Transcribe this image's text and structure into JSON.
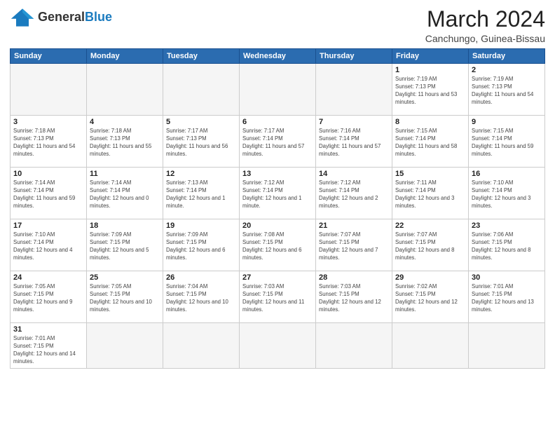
{
  "header": {
    "logo_text_regular": "General",
    "logo_text_bold": "Blue",
    "main_title": "March 2024",
    "subtitle": "Canchungo, Guinea-Bissau"
  },
  "weekdays": [
    "Sunday",
    "Monday",
    "Tuesday",
    "Wednesday",
    "Thursday",
    "Friday",
    "Saturday"
  ],
  "weeks": [
    [
      {
        "day": "",
        "empty": true
      },
      {
        "day": "",
        "empty": true
      },
      {
        "day": "",
        "empty": true
      },
      {
        "day": "",
        "empty": true
      },
      {
        "day": "",
        "empty": true
      },
      {
        "day": "1",
        "sunrise": "7:19 AM",
        "sunset": "7:13 PM",
        "daylight": "11 hours and 53 minutes."
      },
      {
        "day": "2",
        "sunrise": "7:19 AM",
        "sunset": "7:13 PM",
        "daylight": "11 hours and 54 minutes."
      }
    ],
    [
      {
        "day": "3",
        "sunrise": "7:18 AM",
        "sunset": "7:13 PM",
        "daylight": "11 hours and 54 minutes."
      },
      {
        "day": "4",
        "sunrise": "7:18 AM",
        "sunset": "7:13 PM",
        "daylight": "11 hours and 55 minutes."
      },
      {
        "day": "5",
        "sunrise": "7:17 AM",
        "sunset": "7:13 PM",
        "daylight": "11 hours and 56 minutes."
      },
      {
        "day": "6",
        "sunrise": "7:17 AM",
        "sunset": "7:14 PM",
        "daylight": "11 hours and 57 minutes."
      },
      {
        "day": "7",
        "sunrise": "7:16 AM",
        "sunset": "7:14 PM",
        "daylight": "11 hours and 57 minutes."
      },
      {
        "day": "8",
        "sunrise": "7:15 AM",
        "sunset": "7:14 PM",
        "daylight": "11 hours and 58 minutes."
      },
      {
        "day": "9",
        "sunrise": "7:15 AM",
        "sunset": "7:14 PM",
        "daylight": "11 hours and 59 minutes."
      }
    ],
    [
      {
        "day": "10",
        "sunrise": "7:14 AM",
        "sunset": "7:14 PM",
        "daylight": "11 hours and 59 minutes."
      },
      {
        "day": "11",
        "sunrise": "7:14 AM",
        "sunset": "7:14 PM",
        "daylight": "12 hours and 0 minutes."
      },
      {
        "day": "12",
        "sunrise": "7:13 AM",
        "sunset": "7:14 PM",
        "daylight": "12 hours and 1 minute."
      },
      {
        "day": "13",
        "sunrise": "7:12 AM",
        "sunset": "7:14 PM",
        "daylight": "12 hours and 1 minute."
      },
      {
        "day": "14",
        "sunrise": "7:12 AM",
        "sunset": "7:14 PM",
        "daylight": "12 hours and 2 minutes."
      },
      {
        "day": "15",
        "sunrise": "7:11 AM",
        "sunset": "7:14 PM",
        "daylight": "12 hours and 3 minutes."
      },
      {
        "day": "16",
        "sunrise": "7:10 AM",
        "sunset": "7:14 PM",
        "daylight": "12 hours and 3 minutes."
      }
    ],
    [
      {
        "day": "17",
        "sunrise": "7:10 AM",
        "sunset": "7:14 PM",
        "daylight": "12 hours and 4 minutes."
      },
      {
        "day": "18",
        "sunrise": "7:09 AM",
        "sunset": "7:15 PM",
        "daylight": "12 hours and 5 minutes."
      },
      {
        "day": "19",
        "sunrise": "7:09 AM",
        "sunset": "7:15 PM",
        "daylight": "12 hours and 6 minutes."
      },
      {
        "day": "20",
        "sunrise": "7:08 AM",
        "sunset": "7:15 PM",
        "daylight": "12 hours and 6 minutes."
      },
      {
        "day": "21",
        "sunrise": "7:07 AM",
        "sunset": "7:15 PM",
        "daylight": "12 hours and 7 minutes."
      },
      {
        "day": "22",
        "sunrise": "7:07 AM",
        "sunset": "7:15 PM",
        "daylight": "12 hours and 8 minutes."
      },
      {
        "day": "23",
        "sunrise": "7:06 AM",
        "sunset": "7:15 PM",
        "daylight": "12 hours and 8 minutes."
      }
    ],
    [
      {
        "day": "24",
        "sunrise": "7:05 AM",
        "sunset": "7:15 PM",
        "daylight": "12 hours and 9 minutes."
      },
      {
        "day": "25",
        "sunrise": "7:05 AM",
        "sunset": "7:15 PM",
        "daylight": "12 hours and 10 minutes."
      },
      {
        "day": "26",
        "sunrise": "7:04 AM",
        "sunset": "7:15 PM",
        "daylight": "12 hours and 10 minutes."
      },
      {
        "day": "27",
        "sunrise": "7:03 AM",
        "sunset": "7:15 PM",
        "daylight": "12 hours and 11 minutes."
      },
      {
        "day": "28",
        "sunrise": "7:03 AM",
        "sunset": "7:15 PM",
        "daylight": "12 hours and 12 minutes."
      },
      {
        "day": "29",
        "sunrise": "7:02 AM",
        "sunset": "7:15 PM",
        "daylight": "12 hours and 12 minutes."
      },
      {
        "day": "30",
        "sunrise": "7:01 AM",
        "sunset": "7:15 PM",
        "daylight": "12 hours and 13 minutes."
      }
    ],
    [
      {
        "day": "31",
        "sunrise": "7:01 AM",
        "sunset": "7:15 PM",
        "daylight": "12 hours and 14 minutes."
      },
      {
        "day": "",
        "empty": true
      },
      {
        "day": "",
        "empty": true
      },
      {
        "day": "",
        "empty": true
      },
      {
        "day": "",
        "empty": true
      },
      {
        "day": "",
        "empty": true
      },
      {
        "day": "",
        "empty": true
      }
    ]
  ]
}
